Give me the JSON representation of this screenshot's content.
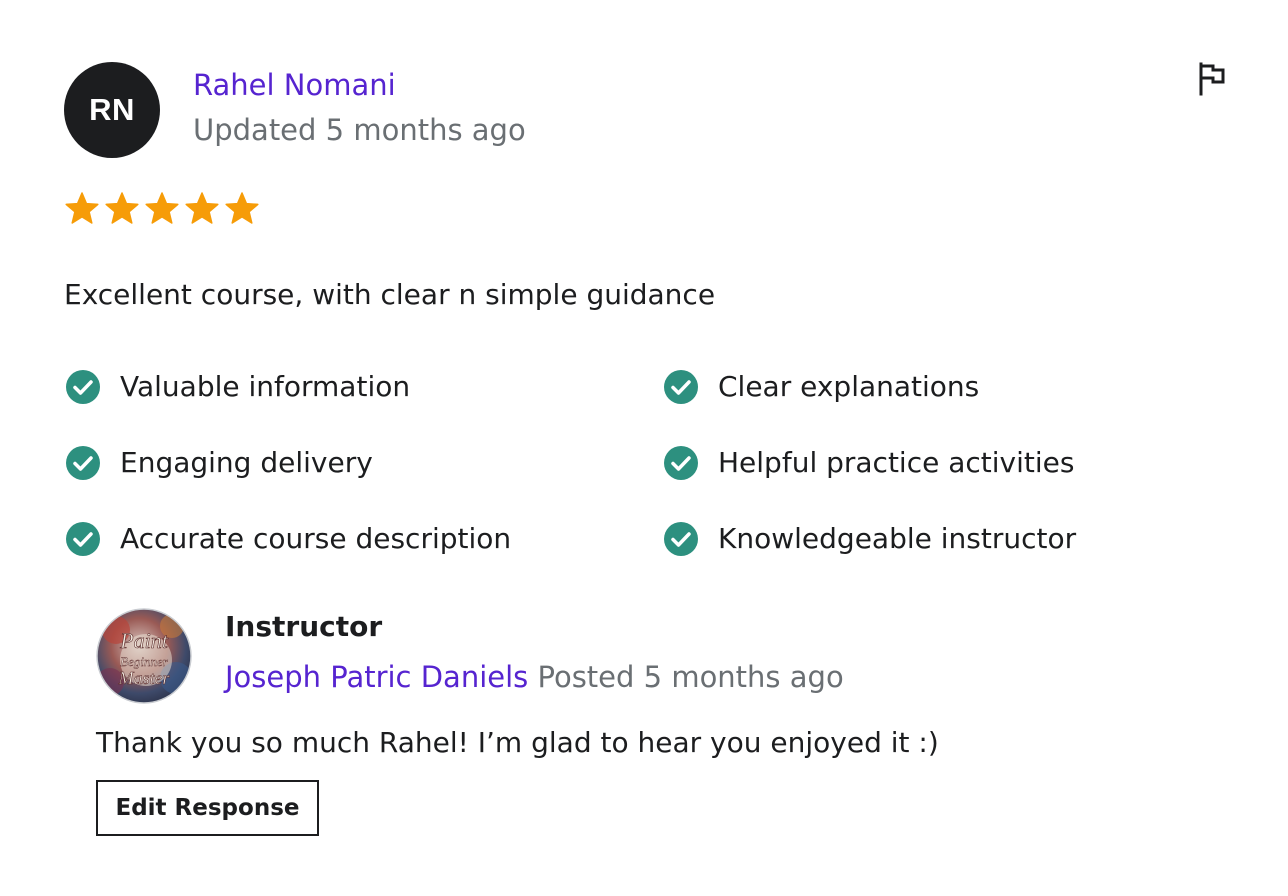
{
  "review": {
    "avatar_initials": "RN",
    "reviewer_name": "Rahel Nomani",
    "updated": "Updated 5 months ago",
    "rating": 5,
    "rating_max": 5,
    "text": "Excellent course, with clear n simple guidance",
    "star_color": "#f69c08"
  },
  "feedback": {
    "check_color": "#2d907f",
    "items": [
      {
        "label": "Valuable information"
      },
      {
        "label": "Clear explanations"
      },
      {
        "label": "Engaging delivery"
      },
      {
        "label": "Helpful practice activities"
      },
      {
        "label": "Accurate course description"
      },
      {
        "label": "Knowledgeable instructor"
      }
    ]
  },
  "response": {
    "heading": "Instructor",
    "instructor_name": "Joseph Patric Daniels",
    "posted": "Posted 5 months ago",
    "text": "Thank you so much Rahel! I’m glad to hear you enjoyed it :)",
    "edit_label": "Edit Response",
    "avatar_logo": [
      "Paint",
      "Beginner",
      "Master"
    ]
  },
  "icons": {
    "flag": "flag-icon",
    "star": "star-icon",
    "check": "check-circle-icon"
  },
  "colors": {
    "link": "#5624d0",
    "muted": "#6a6f73",
    "text": "#1c1d1f"
  }
}
